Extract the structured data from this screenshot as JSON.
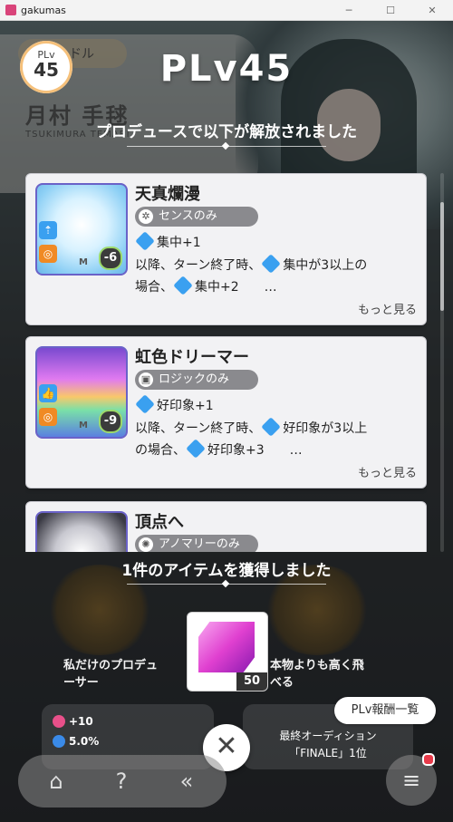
{
  "window": {
    "title": "gakumas"
  },
  "background": {
    "tag": "ドル",
    "name": "月村 手毬",
    "romaji": "TSUKIMURA TEMARI"
  },
  "plv": {
    "badge_label": "PLv",
    "badge_value": "45",
    "title": "PLv45"
  },
  "unlock_heading": "プロデュースで以下が解放されました",
  "cards": [
    {
      "title": "天真爛漫",
      "plan": "センスのみ",
      "cost": "-6",
      "line1_icon_text": "集中+1",
      "line2_a": "以降、ターン終了時、",
      "line2_icon_text": "集中が3以上の",
      "line3_a": "場合、",
      "line3_icon_text": "集中+2",
      "line3_b": "…",
      "more": "もっと見る",
      "card_art_letter": "M",
      "accent": "#3aa0f0"
    },
    {
      "title": "虹色ドリーマー",
      "plan": "ロジックのみ",
      "cost": "-9",
      "line1_icon_text": "好印象+1",
      "line2_a": "以降、ターン終了時、",
      "line2_icon_text": "好印象が3以上",
      "line3_a": "の場合、",
      "line3_icon_text": "好印象+3",
      "line3_b": "…",
      "more": "もっと見る",
      "card_art_letter": "M",
      "accent": "#3aa0f0"
    },
    {
      "title": "頂点へ",
      "plan": "アノマリーのみ"
    }
  ],
  "acquired_heading": "1件のアイテムを獲得しました",
  "item": {
    "icon": "pink-crystal-icon",
    "count": "50"
  },
  "achievements": [
    {
      "label": "私だけのプロデューサー"
    },
    {
      "label": "本物よりも高く飛べる"
    }
  ],
  "stats": {
    "s1": "+10",
    "s2": "5.0%"
  },
  "final": {
    "line1": "最終オーディション",
    "line2": "「FINALE」1位"
  },
  "buttons": {
    "plv_rewards": "PLv報酬一覧",
    "close": "✕"
  },
  "nav": {
    "home": "home-icon",
    "help": "?",
    "back": "«",
    "menu": "≡"
  },
  "colors": {
    "accent_blue": "#3aa0f0",
    "orange": "#f08a24",
    "notif": "#e83a4a"
  }
}
